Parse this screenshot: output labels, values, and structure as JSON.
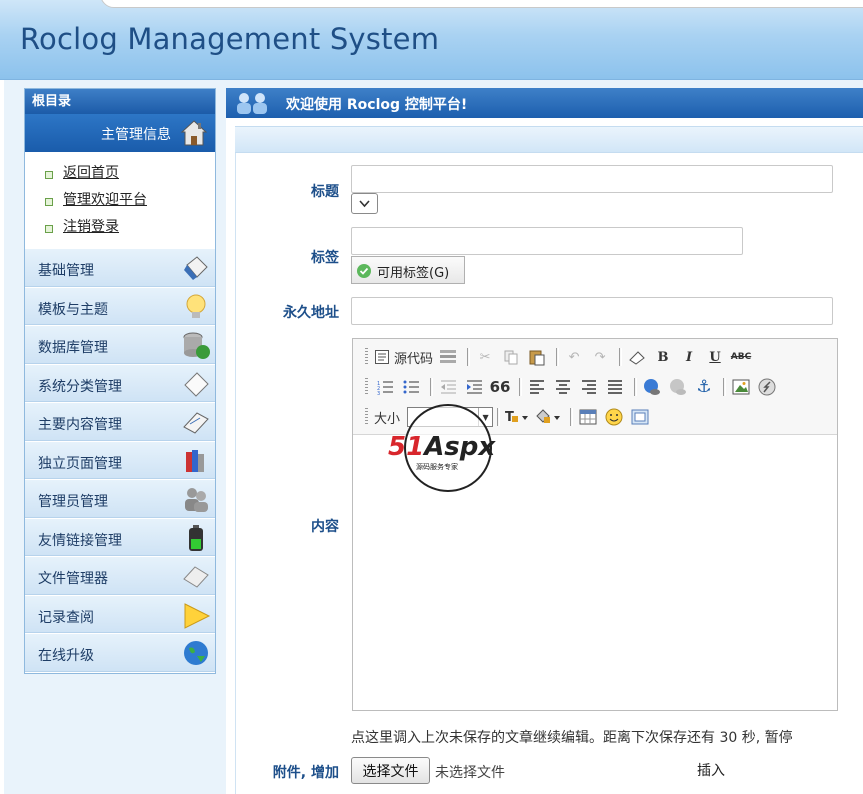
{
  "app": {
    "title": "Roclog Management System"
  },
  "sidebar": {
    "root_title": "根目录",
    "main_info": "主管理信息",
    "quick_links": [
      "返回首页",
      "管理欢迎平台",
      "注销登录"
    ],
    "menu": [
      {
        "label": "基础管理",
        "icon": "eraser-icon"
      },
      {
        "label": "模板与主题",
        "icon": "lightbulb-icon"
      },
      {
        "label": "数据库管理",
        "icon": "database-icon"
      },
      {
        "label": "系统分类管理",
        "icon": "tag-icon"
      },
      {
        "label": "主要内容管理",
        "icon": "book-icon"
      },
      {
        "label": "独立页面管理",
        "icon": "books-icon"
      },
      {
        "label": "管理员管理",
        "icon": "users-icon"
      },
      {
        "label": "友情链接管理",
        "icon": "battery-icon"
      },
      {
        "label": "文件管理器",
        "icon": "file-icon"
      },
      {
        "label": "记录查阅",
        "icon": "triangle-icon"
      },
      {
        "label": "在线升级",
        "icon": "globe-icon"
      }
    ]
  },
  "panel": {
    "header": "欢迎使用 Roclog 控制平台!",
    "fields": {
      "title_label": "标题",
      "tags_label": "标签",
      "tags_button": "可用标签(G)",
      "permalink_label": "永久地址",
      "content_label": "内容",
      "attach_label": "附件, 增加"
    },
    "editor": {
      "source_label": "源代码",
      "size_label": "大小",
      "bold": "B",
      "italic": "I",
      "underline": "U",
      "strike": "ABC",
      "quote": "66"
    },
    "hint": "点这里调入上次未保存的文章继续编辑。距离下次保存还有 30 秒, 暂停",
    "file_button": "选择文件",
    "file_none": "未选择文件",
    "insert": "插入"
  },
  "watermark": {
    "brand": "51Aspx",
    "sub": "源码服务专家"
  },
  "colors": {
    "header_text": "#1f4f86",
    "nav_blue": "#1c5ba8",
    "label_blue": "#1d4f8a"
  }
}
